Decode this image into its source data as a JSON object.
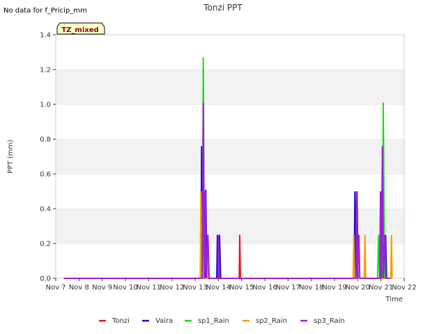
{
  "chart_data": {
    "type": "line",
    "title": "Tonzi PPT",
    "status_text": "No data for f_Pricip_mm",
    "badge": "TZ_mixed",
    "xlabel": "Time",
    "ylabel": "PPT (mm)",
    "ylim": [
      0,
      1.4
    ],
    "yticks": [
      "0.0",
      "0.2",
      "0.4",
      "0.6",
      "0.8",
      "1.0",
      "1.2",
      "1.4"
    ],
    "xlim": [
      7,
      22
    ],
    "xticks": [
      "Nov 7",
      "Nov 8",
      "Nov 9",
      "Nov 10",
      "Nov 11",
      "Nov 12",
      "Nov 13",
      "Nov 14",
      "Nov 15",
      "Nov 16",
      "Nov 17",
      "Nov 18",
      "Nov 19",
      "Nov 20",
      "Nov 21",
      "Nov 22"
    ],
    "grid": "horizontal bands",
    "legend_position": "bottom",
    "series": [
      {
        "name": "Tonzi",
        "color": "#e8101a",
        "points": [
          [
            7.35,
            0
          ],
          [
            14.9,
            0
          ],
          [
            14.92,
            0.25
          ],
          [
            14.95,
            0
          ],
          [
            21.4,
            0
          ]
        ]
      },
      {
        "name": "Vaira",
        "color": "#1010c8",
        "points": [
          [
            7.35,
            0
          ],
          [
            13.25,
            0
          ],
          [
            13.28,
            0.76
          ],
          [
            13.31,
            0
          ],
          [
            13.38,
            0.5
          ],
          [
            13.42,
            0
          ],
          [
            13.46,
            0.51
          ],
          [
            13.5,
            0
          ],
          [
            13.55,
            0.25
          ],
          [
            13.6,
            0
          ],
          [
            13.93,
            0
          ],
          [
            13.96,
            0.25
          ],
          [
            14,
            0
          ],
          [
            14.05,
            0.25
          ],
          [
            14.1,
            0
          ],
          [
            19.85,
            0
          ],
          [
            19.88,
            0.5
          ],
          [
            19.92,
            0
          ],
          [
            19.97,
            0.5
          ],
          [
            20.01,
            0
          ],
          [
            21.0,
            0
          ],
          [
            21.02,
            0.5
          ],
          [
            21.05,
            0
          ],
          [
            21.1,
            0.76
          ],
          [
            21.14,
            0
          ],
          [
            21.2,
            0.25
          ],
          [
            21.24,
            0
          ],
          [
            21.4,
            0
          ]
        ]
      },
      {
        "name": "sp1_Rain",
        "color": "#10e010",
        "points": [
          [
            7.35,
            0
          ],
          [
            13.32,
            0
          ],
          [
            13.35,
            1.27
          ],
          [
            13.4,
            0
          ],
          [
            13.45,
            0.25
          ],
          [
            13.5,
            0
          ],
          [
            20.85,
            0
          ],
          [
            20.9,
            0.25
          ],
          [
            20.94,
            0
          ],
          [
            21.06,
            0
          ],
          [
            21.1,
            1.01
          ],
          [
            21.15,
            0
          ],
          [
            21.4,
            0
          ]
        ]
      },
      {
        "name": "sp2_Rain",
        "color": "#f5a000",
        "points": [
          [
            7.35,
            0
          ],
          [
            13.22,
            0
          ],
          [
            13.25,
            0.5
          ],
          [
            13.28,
            0
          ],
          [
            13.52,
            0
          ],
          [
            13.55,
            0.25
          ],
          [
            13.58,
            0
          ],
          [
            19.8,
            0
          ],
          [
            19.83,
            0.25
          ],
          [
            19.86,
            0
          ],
          [
            20.28,
            0
          ],
          [
            20.31,
            0.25
          ],
          [
            20.34,
            0
          ],
          [
            21.42,
            0
          ],
          [
            21.45,
            0.25
          ],
          [
            21.48,
            0
          ]
        ]
      },
      {
        "name": "sp3_Rain",
        "color": "#9a20d8",
        "points": [
          [
            7.35,
            0
          ],
          [
            13.3,
            0
          ],
          [
            13.35,
            1.01
          ],
          [
            13.4,
            0
          ],
          [
            13.44,
            0.5
          ],
          [
            13.48,
            0
          ],
          [
            13.55,
            0.25
          ],
          [
            13.6,
            0
          ],
          [
            13.98,
            0
          ],
          [
            14.01,
            0.25
          ],
          [
            14.05,
            0
          ],
          [
            19.92,
            0
          ],
          [
            19.95,
            0.5
          ],
          [
            19.99,
            0
          ],
          [
            20.05,
            0.25
          ],
          [
            20.09,
            0
          ],
          [
            20.95,
            0
          ],
          [
            20.98,
            0.5
          ],
          [
            21.02,
            0
          ],
          [
            21.06,
            0.76
          ],
          [
            21.1,
            0
          ],
          [
            21.17,
            0.25
          ],
          [
            21.21,
            0
          ],
          [
            21.4,
            0
          ]
        ]
      }
    ]
  }
}
